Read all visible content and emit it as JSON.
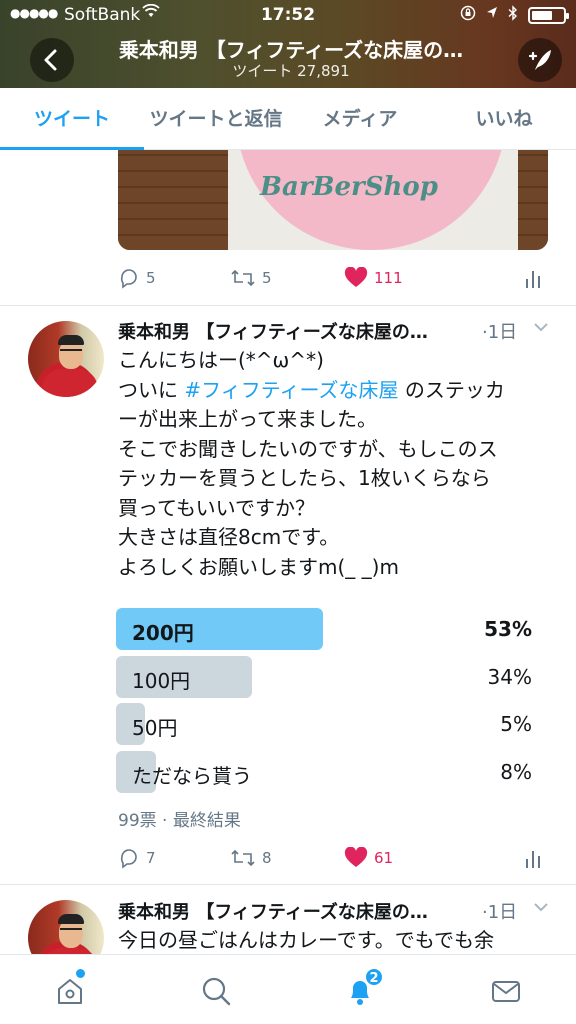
{
  "status_bar": {
    "carrier": "SoftBank",
    "time": "17:52"
  },
  "header": {
    "title": "乗本和男 【フィフティーズな床屋の…",
    "subtitle": "ツイート 27,891"
  },
  "tabs": [
    {
      "label": "ツイート",
      "active": true
    },
    {
      "label": "ツイートと返信",
      "active": false
    },
    {
      "label": "メディア",
      "active": false
    },
    {
      "label": "いいね",
      "active": false
    }
  ],
  "tweet_prev": {
    "image_logo": "BarBerShop",
    "replies": "5",
    "retweets": "5",
    "likes": "111"
  },
  "tweet_main": {
    "author": "乗本和男 【フィフティーズな床屋の…",
    "time": "·1日",
    "body_lines": [
      "こんにちはー(*^ω^*)",
      "ついに ",
      "#フィフティーズな床屋",
      " のステッカ",
      "ーが出来上がって来ました。",
      "そこでお聞きしたいのですが、もしこのス",
      "テッカーを買うとしたら、1枚いくらなら",
      "買ってもいいですか？",
      "大きさは直径8cmです。",
      "よろしくお願いしますm(_ _)m"
    ],
    "poll": {
      "options": [
        {
          "label": "200円",
          "percent_text": "53%",
          "percent": 53,
          "winner": true
        },
        {
          "label": "100円",
          "percent_text": "34%",
          "percent": 34,
          "winner": false
        },
        {
          "label": "50円",
          "percent_text": "5%",
          "percent": 5,
          "winner": false
        },
        {
          "label": "ただなら貰う",
          "percent_text": "8%",
          "percent": 8,
          "winner": false
        }
      ],
      "meta": "99票 · 最終結果"
    },
    "replies": "7",
    "retweets": "8",
    "likes": "61"
  },
  "tweet_next": {
    "author": "乗本和男 【フィフティーズな床屋の…",
    "time": "·1日",
    "body": "今日の昼ごはんはカレーです。でもでも余"
  },
  "bottom_nav": {
    "notifications_badge": "2"
  },
  "colors": {
    "accent": "#1da1f2",
    "like": "#e0245e",
    "poll_winner": "#71c9f8",
    "poll_other": "#ccd6dd"
  }
}
